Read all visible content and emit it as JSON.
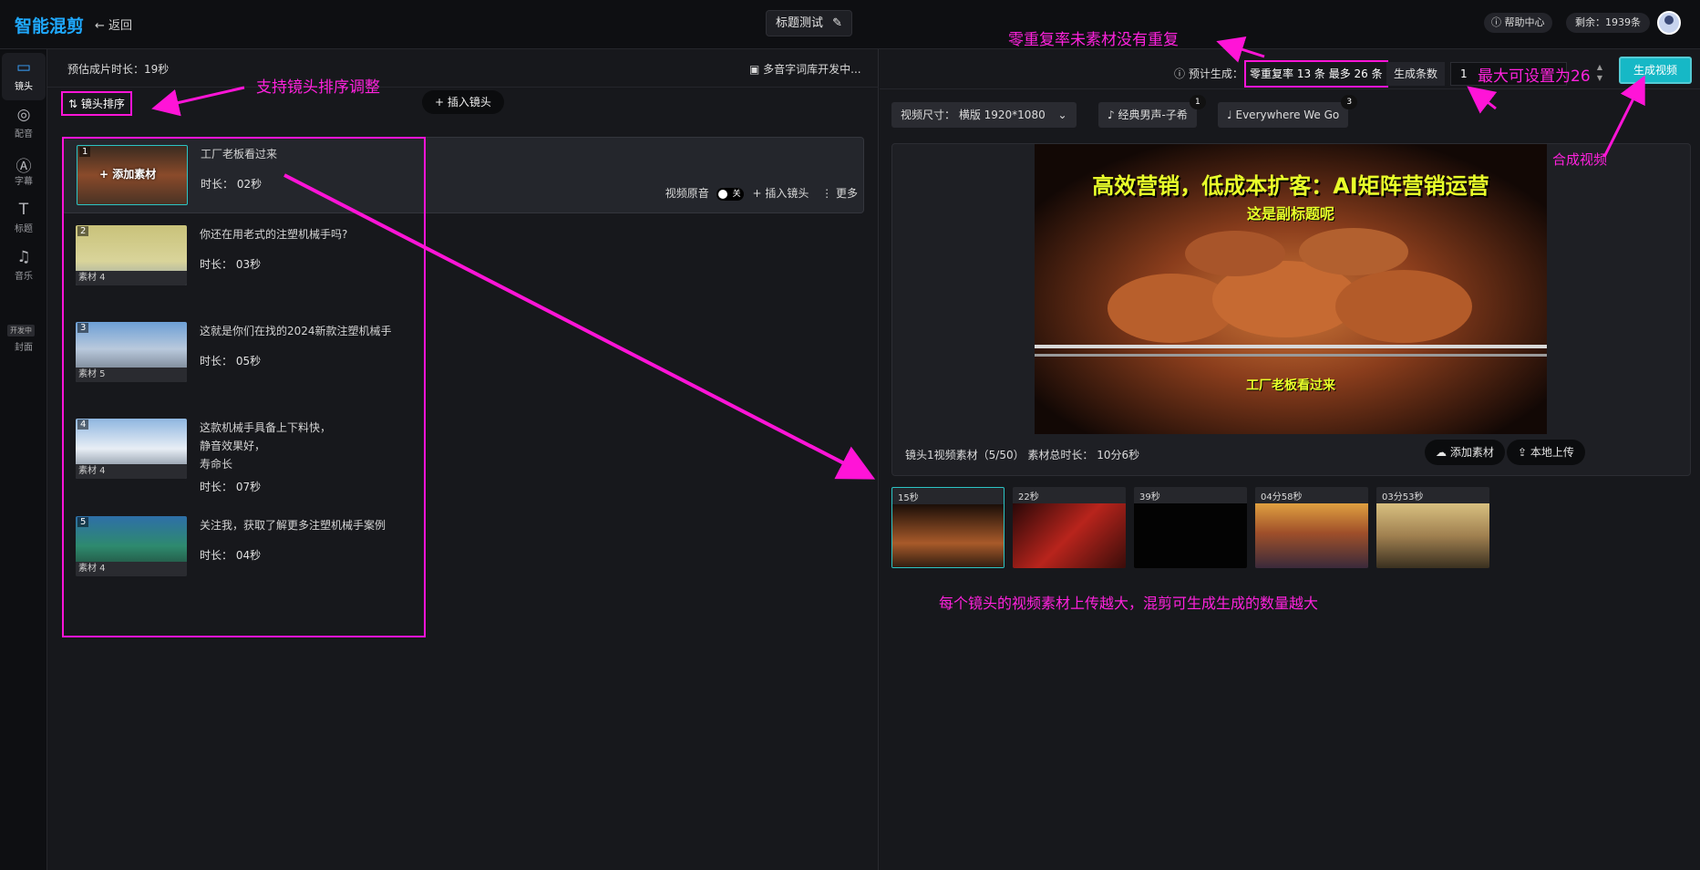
{
  "app": {
    "logo": "智能混剪",
    "back_label": "返回",
    "title": "标题测试"
  },
  "topbar": {
    "help_label": "帮助中心",
    "remaining_label": "剩余：1939条"
  },
  "sidebar": {
    "items": [
      {
        "label": "镜头",
        "icon": "camera-icon"
      },
      {
        "label": "配音",
        "icon": "voice-icon"
      },
      {
        "label": "字幕",
        "icon": "subtitle-icon"
      },
      {
        "label": "标题",
        "icon": "title-icon"
      },
      {
        "label": "音乐",
        "icon": "music-icon"
      },
      {
        "label": "封面",
        "icon": "cover-icon"
      }
    ],
    "dev_tag": "开发中"
  },
  "left": {
    "estimate_label": "预估成片时长：",
    "estimate_value": "19秒",
    "polyphone_label": "多音字词库开发中...",
    "sort_label": "镜头排序",
    "insert_label": "插入镜头",
    "shots": [
      {
        "num": "1",
        "text": "工厂老板看过来",
        "duration": "时长：  02秒",
        "thumb_label": "+ 添加素材"
      },
      {
        "num": "2",
        "text": "你还在用老式的注塑机械手吗?",
        "duration": "时长：  03秒",
        "material": "素材 4"
      },
      {
        "num": "3",
        "text": "这就是你们在找的2024新款注塑机械手",
        "duration": "时长：  05秒",
        "material": "素材 5"
      },
      {
        "num": "4",
        "text_lines": [
          "这款机械手具备上下料快，",
          "静音效果好，",
          "寿命长"
        ],
        "duration": "时长：  07秒",
        "material": "素材 4"
      },
      {
        "num": "5",
        "text": "关注我，获取了解更多注塑机械手案例",
        "duration": "时长：  04秒",
        "material": "素材 4"
      }
    ],
    "shot_actions": {
      "original_audio": "视频原音",
      "toggle_state": "关",
      "insert": "插入镜头",
      "more": "更多"
    }
  },
  "right": {
    "predict_label": "预计生成：",
    "predict_value": "零重复率 13 条 最多 26 条",
    "count_label": "生成条数",
    "count_value": "1",
    "generate_label": "生成视频",
    "size_option": "视频尺寸：   横版 1920*1080",
    "voice_option": "经典男声-子希",
    "voice_badge": "1",
    "music_option": "Everywhere We Go",
    "music_badge": "3",
    "video_title": "高效营销，低成本扩客：AI矩阵营销运营",
    "video_subtitle": "这是副标题呢",
    "video_caption": "工厂老板看过来",
    "preview_info": "镜头1视频素材（5/50）   素材总时长：  10分6秒",
    "add_material": "添加素材",
    "local_upload": "本地上传",
    "clips": [
      {
        "length": "15秒",
        "theme": "crayfish"
      },
      {
        "length": "22秒",
        "theme": "lobster"
      },
      {
        "length": "39秒",
        "theme": "black"
      },
      {
        "length": "04分58秒",
        "theme": "city"
      },
      {
        "length": "03分53秒",
        "theme": "mountain"
      }
    ]
  },
  "annotations": {
    "zero_repeat": "零重复率未素材没有重复",
    "sort_support": "支持镜头排序调整",
    "max_set": "最大可设置为26",
    "compose": "合成视频",
    "more_clips": "每个镜头的视频素材上传越大，混剪可生成生成的数量越大"
  },
  "colors": {
    "accent": "#16b8c6",
    "annotation": "#ff14d7",
    "logo": "#1fa9ff",
    "caption": "#e9ff2a"
  }
}
